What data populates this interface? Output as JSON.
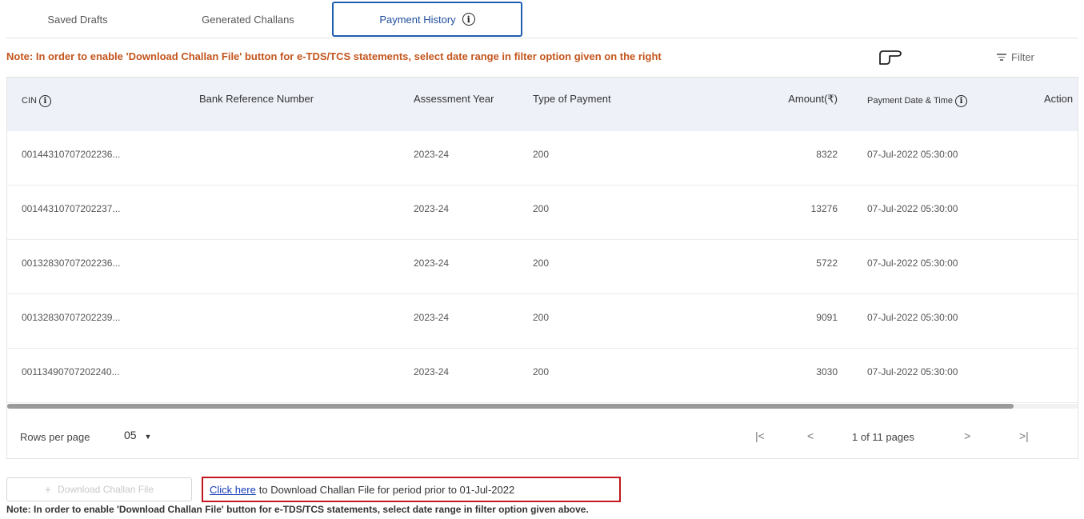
{
  "tabs": [
    {
      "label": "Saved Drafts"
    },
    {
      "label": "Generated Challans"
    },
    {
      "label": "Payment History"
    }
  ],
  "note_top": "Note: In order to enable 'Download Challan File' button for e-TDS/TCS statements, select date range in filter option given on the right",
  "filter_label": "Filter",
  "table": {
    "columns": [
      "CIN",
      "Bank Reference Number",
      "Assessment Year",
      "Type of Payment",
      "Amount(₹)",
      "Payment Date & Time",
      "Action"
    ],
    "rows": [
      {
        "cin": "00144310707202236...",
        "bank_ref": "",
        "year": "2023-24",
        "type": "200",
        "amount": "8322",
        "date": "07-Jul-2022 05:30:00"
      },
      {
        "cin": "00144310707202237...",
        "bank_ref": "",
        "year": "2023-24",
        "type": "200",
        "amount": "13276",
        "date": "07-Jul-2022 05:30:00"
      },
      {
        "cin": "00132830707202236...",
        "bank_ref": "",
        "year": "2023-24",
        "type": "200",
        "amount": "5722",
        "date": "07-Jul-2022 05:30:00"
      },
      {
        "cin": "00132830707202239...",
        "bank_ref": "",
        "year": "2023-24",
        "type": "200",
        "amount": "9091",
        "date": "07-Jul-2022 05:30:00"
      },
      {
        "cin": "00113490707202240...",
        "bank_ref": "",
        "year": "2023-24",
        "type": "200",
        "amount": "3030",
        "date": "07-Jul-2022 05:30:00"
      }
    ]
  },
  "pager": {
    "rows_per_page_label": "Rows per page",
    "rows_per_page_value": "05",
    "first": "|<",
    "prev": "<",
    "page_text": "1 of 11 pages",
    "next": ">",
    "last": ">|"
  },
  "download_button": {
    "label": "Download Challan File",
    "icon": "+"
  },
  "click_here": {
    "link": "Click here",
    "text": "to Download Challan File for period prior to 01-Jul-2022"
  },
  "note_bottom": "Note: In order to enable 'Download Challan File' button for e-TDS/TCS statements, select date range in filter option given above."
}
